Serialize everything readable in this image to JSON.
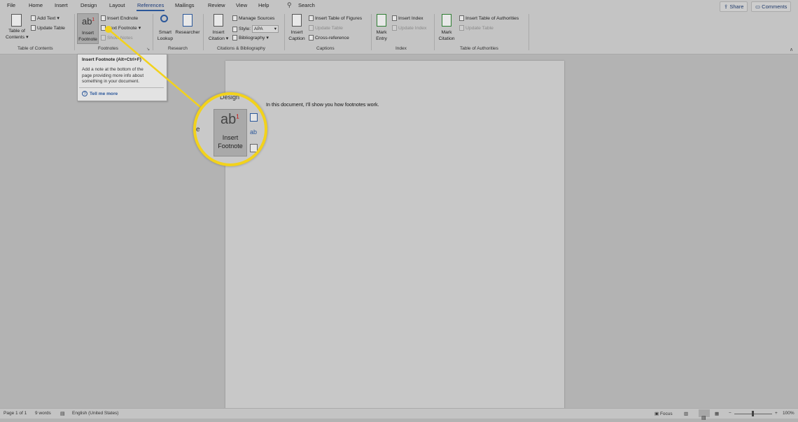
{
  "menu": {
    "tabs": [
      "File",
      "Home",
      "Insert",
      "Design",
      "Layout",
      "References",
      "Mailings",
      "Review",
      "View",
      "Help"
    ],
    "search_label": "Search",
    "share_label": "Share",
    "comments_label": "Comments"
  },
  "ribbon": {
    "toc": {
      "table_of_contents": "Table of",
      "table_of_contents_2": "Contents",
      "add_text": "Add Text",
      "update_table": "Update Table",
      "group_label": "Table of Contents"
    },
    "footnotes": {
      "insert_footnote": "Insert",
      "insert_footnote_2": "Footnote",
      "insert_endnote": "Insert Endnote",
      "next_footnote": "Next Footnote",
      "show_notes": "Show Notes",
      "group_label": "Footnotes",
      "icon_text": "ab",
      "superscript": "1"
    },
    "research": {
      "smart_lookup": "Smart",
      "smart_lookup_2": "Lookup",
      "researcher": "Researcher",
      "group_label": "Research"
    },
    "citations": {
      "insert_citation": "Insert",
      "insert_citation_2": "Citation",
      "manage_sources": "Manage Sources",
      "style_label": "Style:",
      "style_value": "APA",
      "bibliography": "Bibliography",
      "group_label": "Citations & Bibliography"
    },
    "captions": {
      "insert_caption": "Insert",
      "insert_caption_2": "Caption",
      "insert_table_of_figures": "Insert Table of Figures",
      "update_table": "Update Table",
      "cross_reference": "Cross-reference",
      "group_label": "Captions"
    },
    "index": {
      "mark_entry": "Mark",
      "mark_entry_2": "Entry",
      "insert_index": "Insert Index",
      "update_index": "Update Index",
      "group_label": "Index"
    },
    "authorities": {
      "mark_citation": "Mark",
      "mark_citation_2": "Citation",
      "insert_toa": "Insert Table of Authorities",
      "update_table": "Update Table",
      "group_label": "Table of Authorities"
    }
  },
  "tooltip": {
    "title": "Insert Footnote (Alt+Ctrl+F)",
    "body_1": "Add a note at the bottom of the",
    "body_2": "page providing more info about",
    "body_3": "something in your document.",
    "tell_me_more": "Tell me more"
  },
  "document": {
    "text": "In this document, I'll show you how footnotes work."
  },
  "magnifier": {
    "tab_text": "Design",
    "side_letter": "e",
    "icon_text": "ab",
    "superscript": "1",
    "label_1": "Insert",
    "label_2": "Footnote"
  },
  "status": {
    "page": "Page 1 of 1",
    "words": "9 words",
    "language": "English (United States)",
    "focus": "Focus",
    "zoom": "100%",
    "zoom_minus": "−",
    "zoom_plus": "+"
  },
  "colors": {
    "highlight": "#f2d21c",
    "accent": "#2b579a",
    "link": "#2b579a"
  }
}
